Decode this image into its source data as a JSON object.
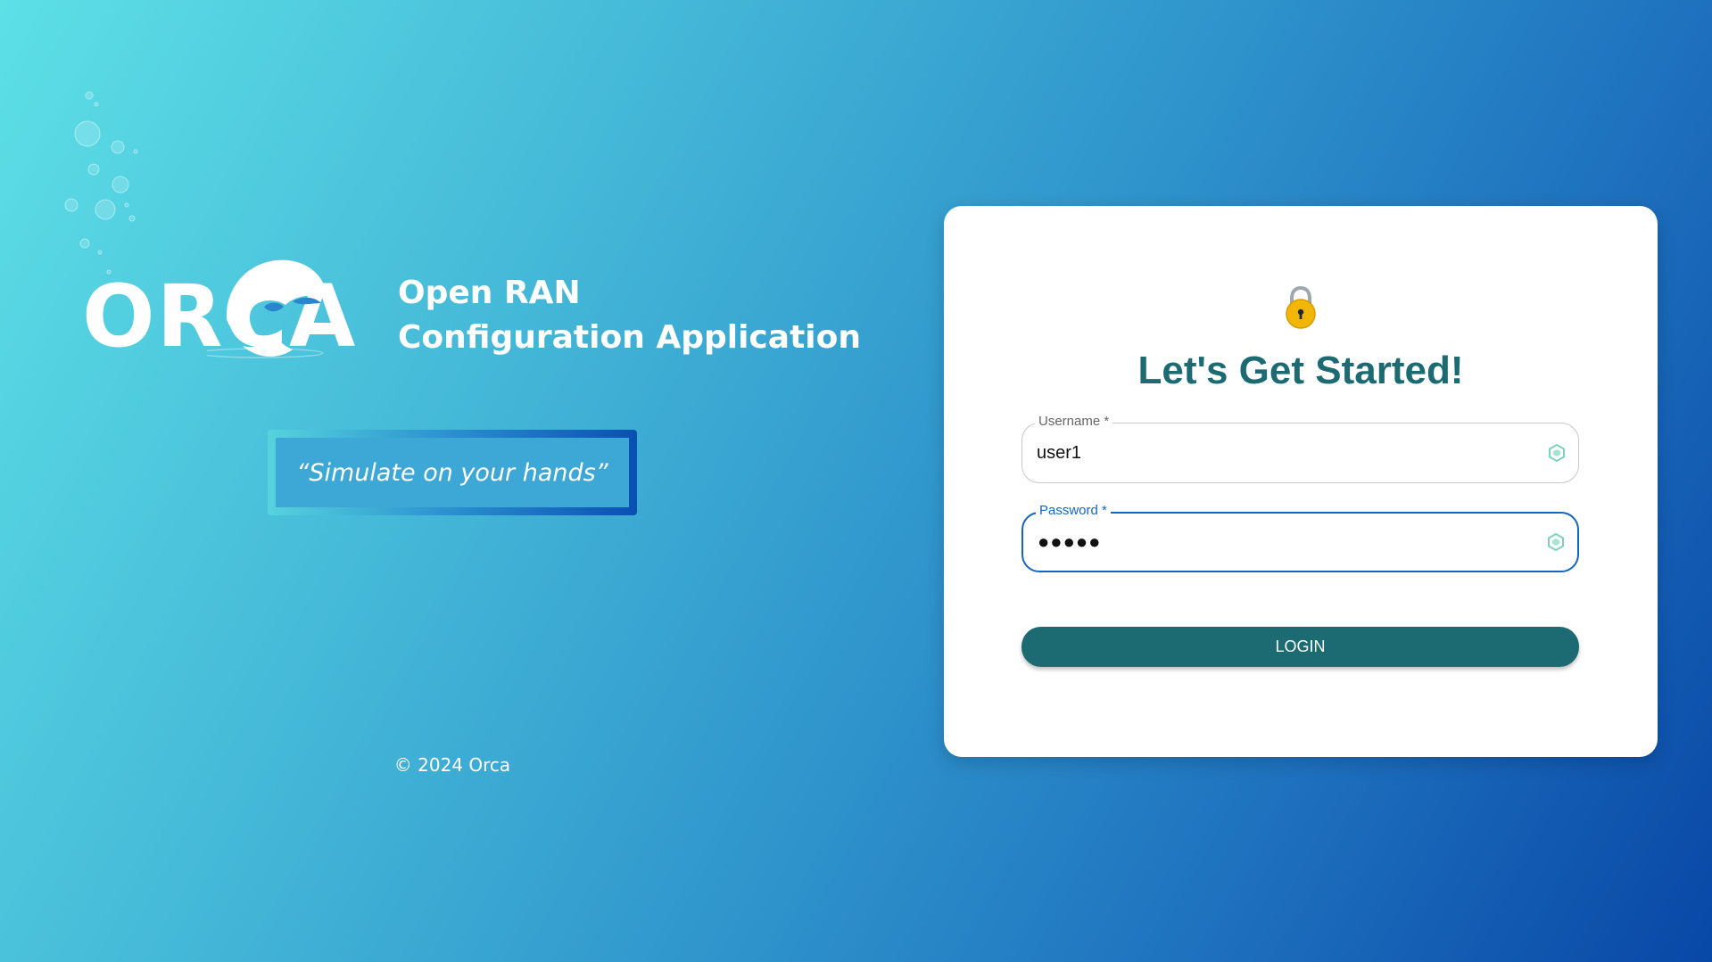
{
  "brand": {
    "logo_text": "ORCA",
    "app_name_line1": "Open RAN",
    "app_name_line2": "Configuration Application",
    "quote": "“Simulate on your hands”",
    "copyright": "© 2024 Orca"
  },
  "login": {
    "title": "Let's Get Started!",
    "username_label": "Username *",
    "username_value": "user1",
    "password_label": "Password *",
    "password_value": "●●●●●",
    "button_label": "LOGIN"
  },
  "colors": {
    "accent": "#1c6b73",
    "focus": "#1565c0",
    "lock_body": "#f2b705"
  },
  "icons": {
    "lock": "lock-icon",
    "field_autofill": "password-manager-icon"
  }
}
